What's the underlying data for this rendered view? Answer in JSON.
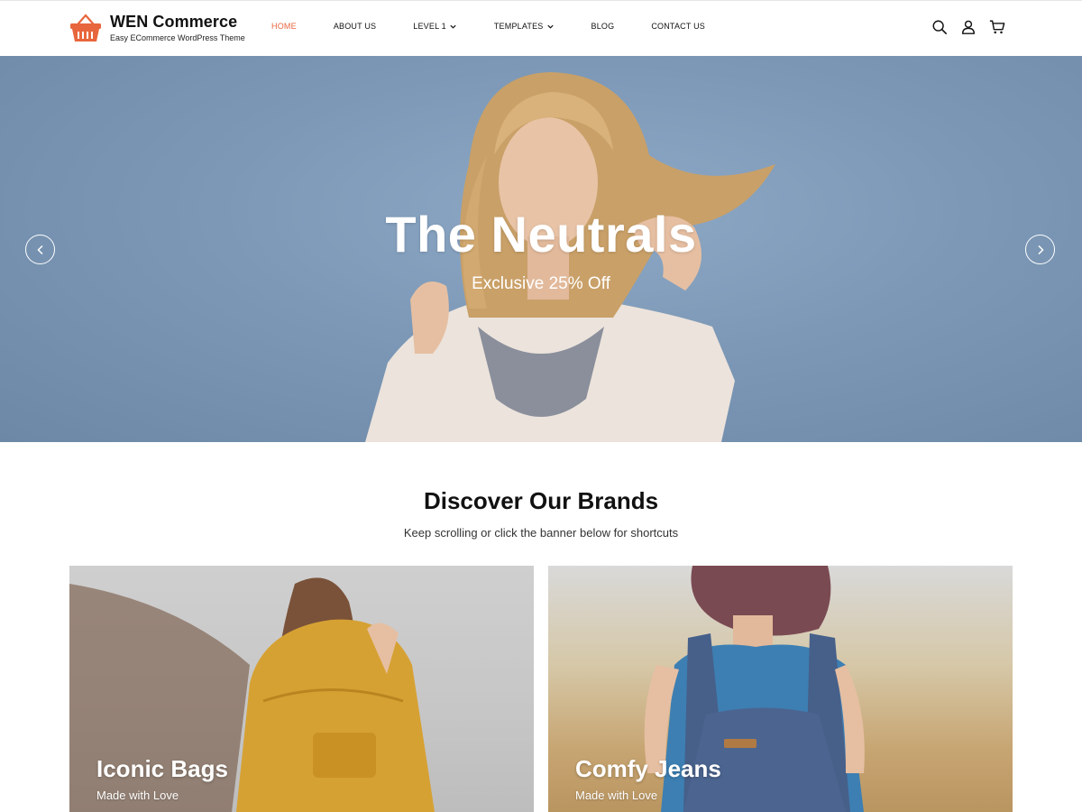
{
  "header": {
    "logo_title": "WEN Commerce",
    "logo_tagline": "Easy ECommerce WordPress Theme",
    "nav": [
      {
        "label": "HOME"
      },
      {
        "label": "ABOUT US"
      },
      {
        "label": "LEVEL 1"
      },
      {
        "label": "TEMPLATES"
      },
      {
        "label": "BLOG"
      },
      {
        "label": "CONTACT US"
      }
    ],
    "icons": [
      "search-icon",
      "user-icon",
      "cart-icon"
    ]
  },
  "hero": {
    "title": "The Neutrals",
    "subtitle": "Exclusive 25% Off"
  },
  "brands": {
    "title": "Discover Our Brands",
    "subtitle": "Keep scrolling or click the banner below for shortcuts",
    "cards": [
      {
        "title": "Iconic Bags",
        "subtitle": "Made with Love"
      },
      {
        "title": "Comfy Jeans",
        "subtitle": "Made with Love"
      }
    ]
  },
  "colors": {
    "accent": "#e8663d",
    "hero_bg": "#7c98b6",
    "text": "#111111"
  }
}
